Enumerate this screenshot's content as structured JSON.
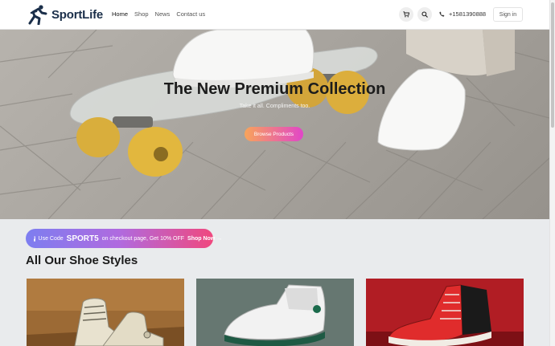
{
  "header": {
    "brand": "SportLife",
    "nav": [
      "Home",
      "Shop",
      "News",
      "Contact us"
    ],
    "phone": "+1581390888",
    "signin_label": "Sign in"
  },
  "hero": {
    "title": "The New Premium Collection",
    "subtitle": "Take it all. Compliments too.",
    "button_label": "Browse Products"
  },
  "promo": {
    "prefix": "Use Code",
    "code": "SPORT5",
    "middle": "on checkout page, Get 10% OFF",
    "link": "Shop Now →"
  },
  "section": {
    "title": "All Our Shoe Styles"
  },
  "products": [
    {
      "icon": "sneaker-vintage-image"
    },
    {
      "icon": "sneaker-basketball-image"
    },
    {
      "icon": "sneaker-hightop-red-image"
    }
  ],
  "colors": {
    "brand": "#1b2f4a",
    "promo_start": "#7d7ef0",
    "promo_end": "#f0487e",
    "button_start": "#f8a45a",
    "button_end": "#e146c8"
  }
}
